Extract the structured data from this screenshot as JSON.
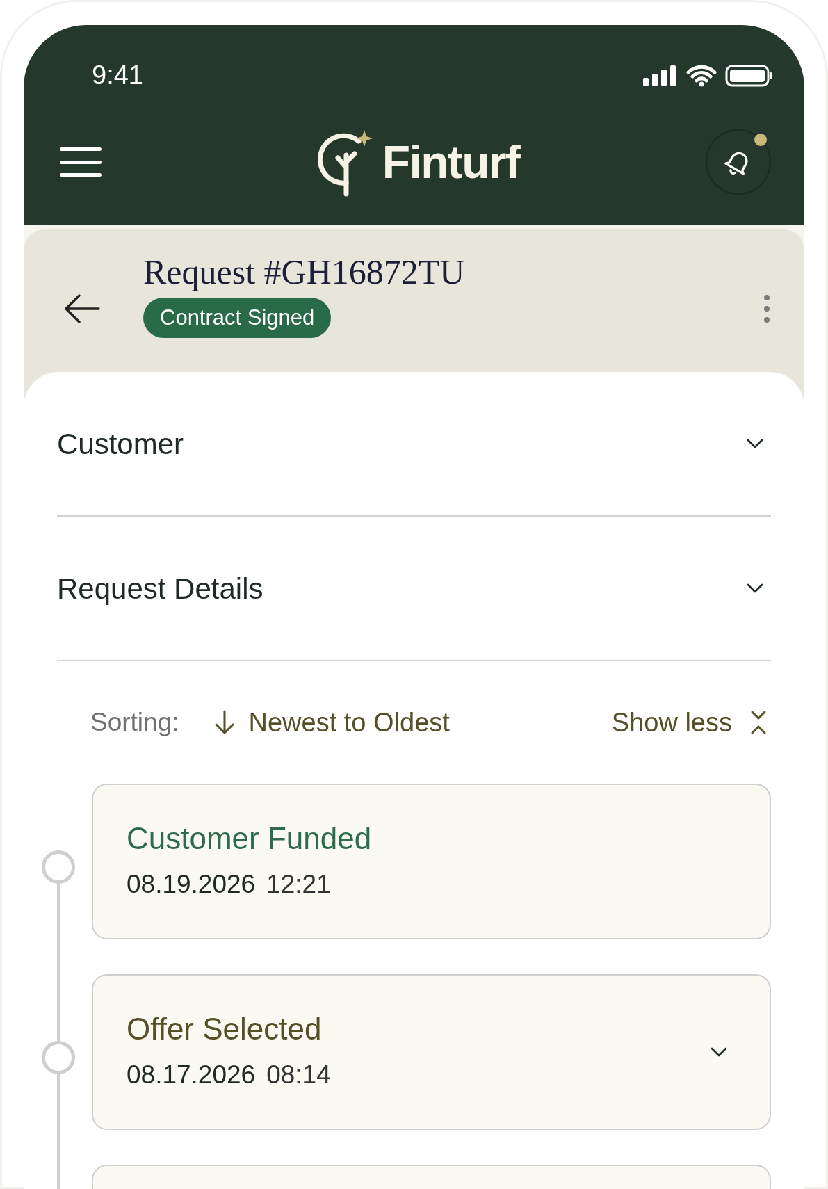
{
  "status_bar": {
    "time": "9:41"
  },
  "app_bar": {
    "logo": "Finturf",
    "notifications_unread": true
  },
  "request": {
    "title": "Request #GH16872TU",
    "status": "Contract Signed"
  },
  "sections": [
    {
      "label": "Customer",
      "expanded": false
    },
    {
      "label": "Request Details",
      "expanded": false
    }
  ],
  "sorting": {
    "label": "Sorting:",
    "value": "Newest to Oldest",
    "toggle": "Show less"
  },
  "timeline": [
    {
      "kind": "event",
      "title": "Customer Funded",
      "color": "#2e6b48",
      "date": "08.19.2026",
      "time": "12:21",
      "expandable": false
    },
    {
      "kind": "event",
      "title": "Offer Selected",
      "color": "#555028",
      "date": "08.17.2026",
      "time": "08:14",
      "expandable": true
    },
    {
      "kind": "cut-off",
      "expandable": false
    }
  ]
}
